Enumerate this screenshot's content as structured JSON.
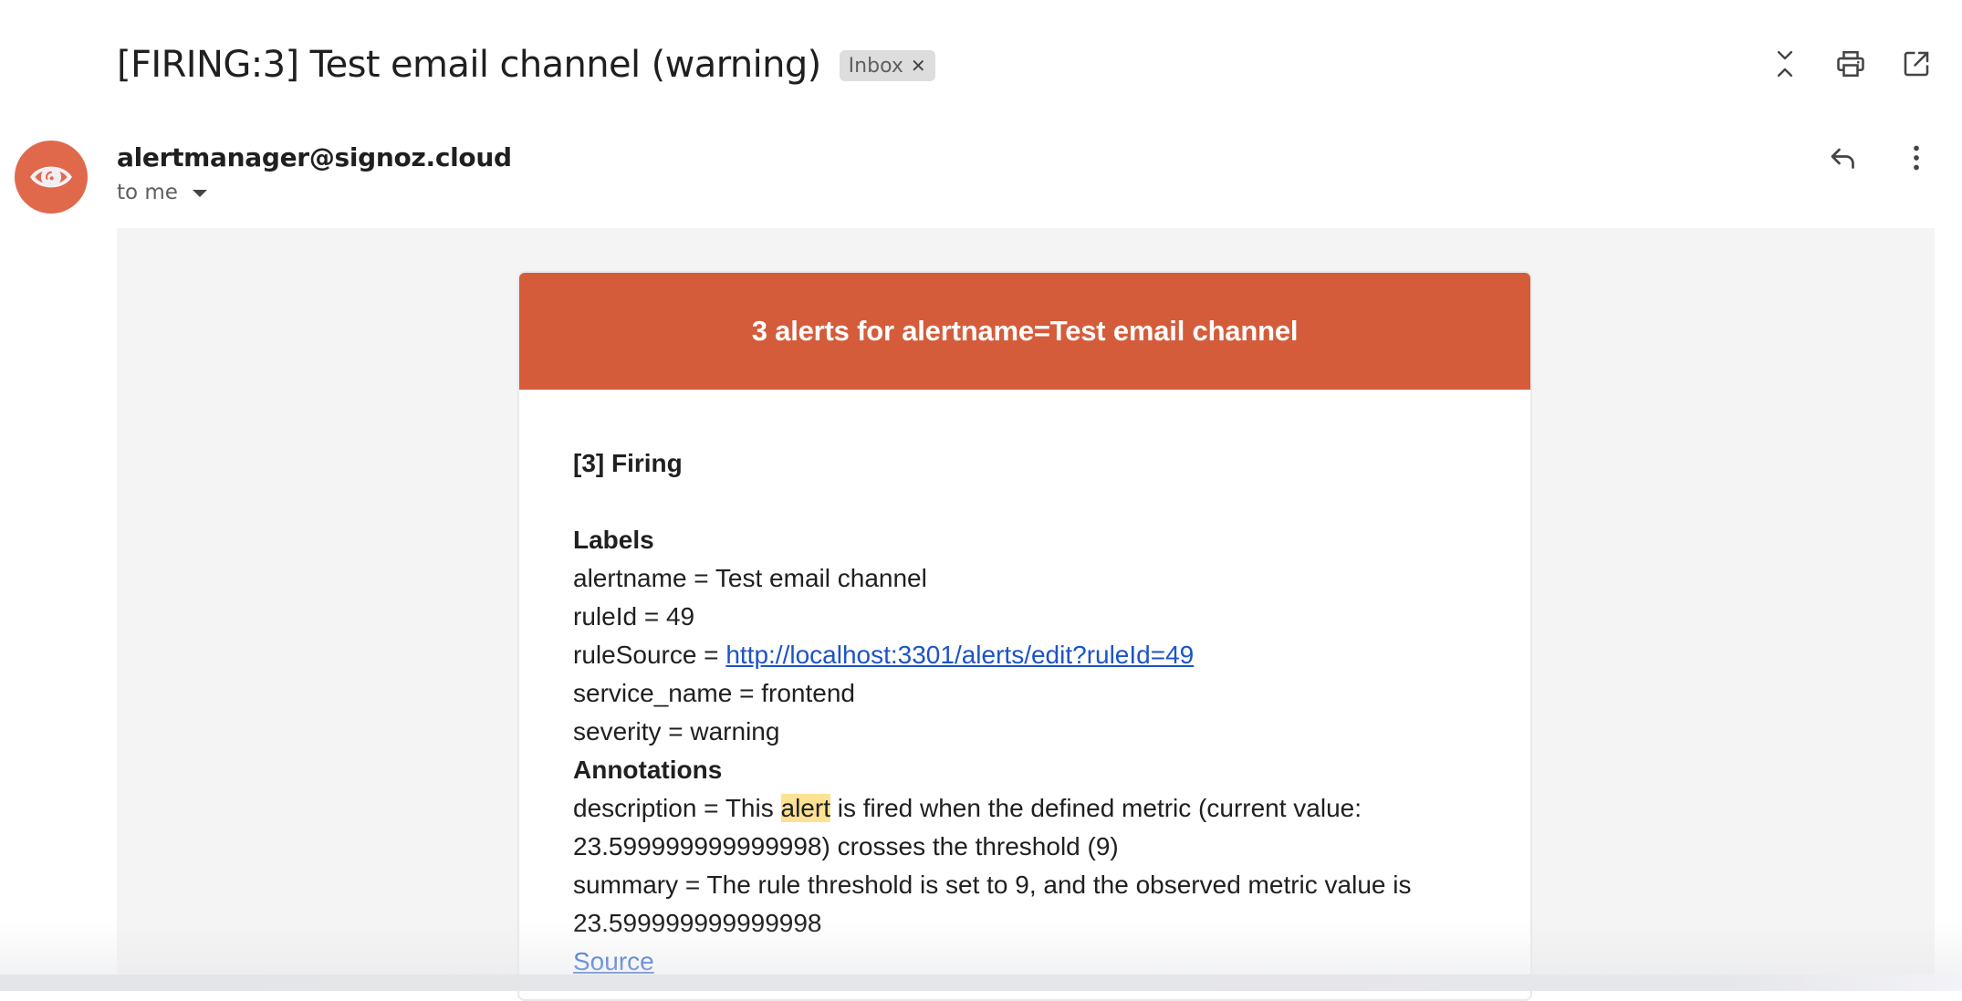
{
  "header": {
    "subject": "[FIRING:3] Test email channel (warning)",
    "label_chip": {
      "text": "Inbox",
      "remove_icon": "close-icon"
    },
    "actions": [
      {
        "name": "collapse-all",
        "icon": "unfold-less-icon"
      },
      {
        "name": "print-all",
        "icon": "print-icon"
      },
      {
        "name": "open-in-new-window",
        "icon": "open-in-new-icon"
      }
    ]
  },
  "message": {
    "sender": "alertmanager@signoz.cloud",
    "recipient_text": "to me",
    "avatar": {
      "icon": "eye-icon",
      "color": "#e0694c"
    },
    "actions": [
      {
        "name": "reply",
        "icon": "reply-icon"
      },
      {
        "name": "more",
        "icon": "more-vert-icon"
      }
    ]
  },
  "email_body": {
    "banner_title": "3 alerts for alertname=Test email channel",
    "banner_color": "#d45c3a",
    "firing_heading": "[3] Firing",
    "labels_heading": "Labels",
    "labels": [
      {
        "key": "alertname",
        "value": "Test email channel"
      },
      {
        "key": "ruleId",
        "value": "49"
      },
      {
        "key": "ruleSource",
        "value": "http://localhost:3301/alerts/edit?ruleId=49",
        "is_link": true
      },
      {
        "key": "service_name",
        "value": "frontend"
      },
      {
        "key": "severity",
        "value": "warning"
      }
    ],
    "annotations_heading": "Annotations",
    "annotations": {
      "description": {
        "key": "description",
        "prefix": "This ",
        "highlight": "alert",
        "suffix": " is fired when the defined metric (current value: 23.599999999999998) crosses the threshold (9)"
      },
      "summary": {
        "key": "summary",
        "value": "The rule threshold is set to 9, and the observed metric value is 23.599999999999998"
      }
    },
    "source_link": "Source",
    "separator": " = "
  }
}
